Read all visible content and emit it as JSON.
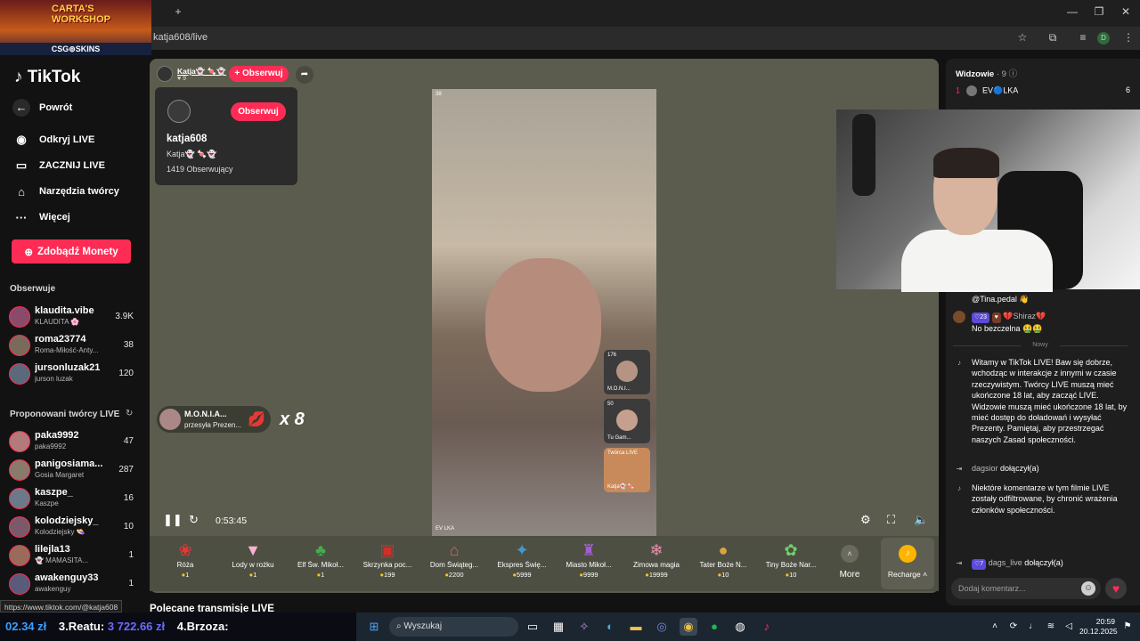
{
  "browser": {
    "url": "katja608/live",
    "new_tab_icon": "plus",
    "window_controls": [
      "minimize",
      "restore",
      "close"
    ]
  },
  "promo_overlay": {
    "title": "CARTA'S WORKSHOP",
    "brand": "CSG⊚SKINS"
  },
  "sidebar": {
    "logo": "TikTok",
    "back": "Powrót",
    "nav": [
      {
        "label": "Odkryj LIVE",
        "icon": "live-icon"
      },
      {
        "label": "ZACZNIJ LIVE",
        "icon": "camera-icon"
      },
      {
        "label": "Narzędzia twórcy",
        "icon": "home-icon"
      },
      {
        "label": "Więcej",
        "icon": "more-icon"
      }
    ],
    "coins_button": "Zdobądź Monety",
    "following_title": "Obserwuje",
    "following": [
      {
        "name": "klaudita.vibe",
        "sub": "KLAUDITA 🌸",
        "count": "3.9K"
      },
      {
        "name": "roma23774",
        "sub": "Roma-Miłość-Anty...",
        "count": "38"
      },
      {
        "name": "jursonluzak21",
        "sub": "jurson luzak",
        "count": "120"
      }
    ],
    "suggested_title": "Proponowani twórcy LIVE",
    "suggested": [
      {
        "name": "paka9992",
        "sub": "paka9992",
        "count": "47"
      },
      {
        "name": "panigosiama...",
        "sub": "Gosia Margaret",
        "count": "287"
      },
      {
        "name": "kaszpe_",
        "sub": "Kaszpe",
        "count": "16"
      },
      {
        "name": "kolodziejsky_",
        "sub": "Kolodziejsky 👒",
        "count": "10"
      },
      {
        "name": "lilejla13",
        "sub": "👻 MAMASITA...",
        "count": "1"
      },
      {
        "name": "awakenguy33",
        "sub": "awakenguy",
        "count": "1"
      }
    ],
    "status_url": "https://www.tiktok.com/@katja608"
  },
  "player": {
    "host_name": "Katja👻 🍬👻",
    "host_likes": "9",
    "follow": "+ Obserwuj",
    "card": {
      "follow": "Obserwuj",
      "username": "katja608",
      "nickname": "Katja👻 🍬👻",
      "followers": "1419 Obserwujący"
    },
    "gift_notification": {
      "user": "M.O.N.I.A...",
      "text": "przesyła Prezen...",
      "multiplier": "x 8"
    },
    "viewer_count_tag": "38",
    "video_label": "EV LKA",
    "side_tiles": [
      {
        "viewers": "176",
        "label": "M.O.N.I..."
      },
      {
        "viewers": "50",
        "label": "Tu Gam..."
      },
      {
        "viewers": "",
        "label": "Katja👻 🍬"
      }
    ],
    "side_tile_badge": "Twórca LIVE",
    "elapsed": "0:53:45"
  },
  "gifts": [
    {
      "name": "Róża",
      "price": "1",
      "icon": "rose-icon"
    },
    {
      "name": "Lody w rożku",
      "price": "1",
      "icon": "ice-cream-icon"
    },
    {
      "name": "Elf Św. Mikoł...",
      "price": "1",
      "icon": "elf-icon"
    },
    {
      "name": "Skrzynka poc...",
      "price": "199",
      "icon": "mailbox-icon"
    },
    {
      "name": "Dom Świąteg...",
      "price": "2200",
      "icon": "house-icon"
    },
    {
      "name": "Ekspres Świę...",
      "price": "5999",
      "icon": "train-icon"
    },
    {
      "name": "Miasto Mikoł...",
      "price": "9999",
      "icon": "city-icon"
    },
    {
      "name": "Zimowa magia",
      "price": "19999",
      "icon": "winter-icon"
    },
    {
      "name": "Tater Boże N...",
      "price": "10",
      "icon": "potato-icon"
    },
    {
      "name": "Tiny Boże Nar...",
      "price": "10",
      "icon": "tiny-icon"
    }
  ],
  "more_label": "More",
  "recharge_label": "Recharge",
  "recommended_title": "Polecane transmisje LIVE",
  "chat": {
    "viewers_label": "Widzowie",
    "viewers_count": "· 9",
    "top_viewer": {
      "rank": "1",
      "name": "EV🔵LKA",
      "score": "6"
    },
    "messages": [
      {
        "badges": "23",
        "user": "💔Shiraz💔",
        "text": "No bezczelna 🤮🤮"
      }
    ],
    "first_mention": "@Tina.pedal 👋",
    "new_label": "Nowy",
    "welcome": "Witamy w TikTok LIVE! Baw się dobrze, wchodząc w interakcje z innymi w czasie rzeczywistym. Twórcy LIVE muszą mieć ukończone 18 lat, aby zacząć LIVE. Widzowie muszą mieć ukończone 18 lat, by mieć dostęp do doładowań i wysyłać Prezenty. Pamiętaj, aby przestrzegać naszych Zasad społeczności.",
    "join1_user": "dagsior",
    "join_text": "dołączył(a)",
    "filter_note": "Niektóre komentarze w tym filmie LIVE zostały odfiltrowane, by chronić wrażenia członków społeczności.",
    "join2_badge": "7",
    "join2_user": "dags_live",
    "comment_placeholder": "Dodaj komentarz..."
  },
  "taskbar": {
    "ticker_rank": "02.34 zł",
    "ticker_3": "3.Reatu:",
    "ticker_3_val": "3 722.66 zł",
    "ticker_4": "4.Brzoza:",
    "search": "Wyszukaj",
    "time": "20:59",
    "date": "20.12.2025"
  }
}
